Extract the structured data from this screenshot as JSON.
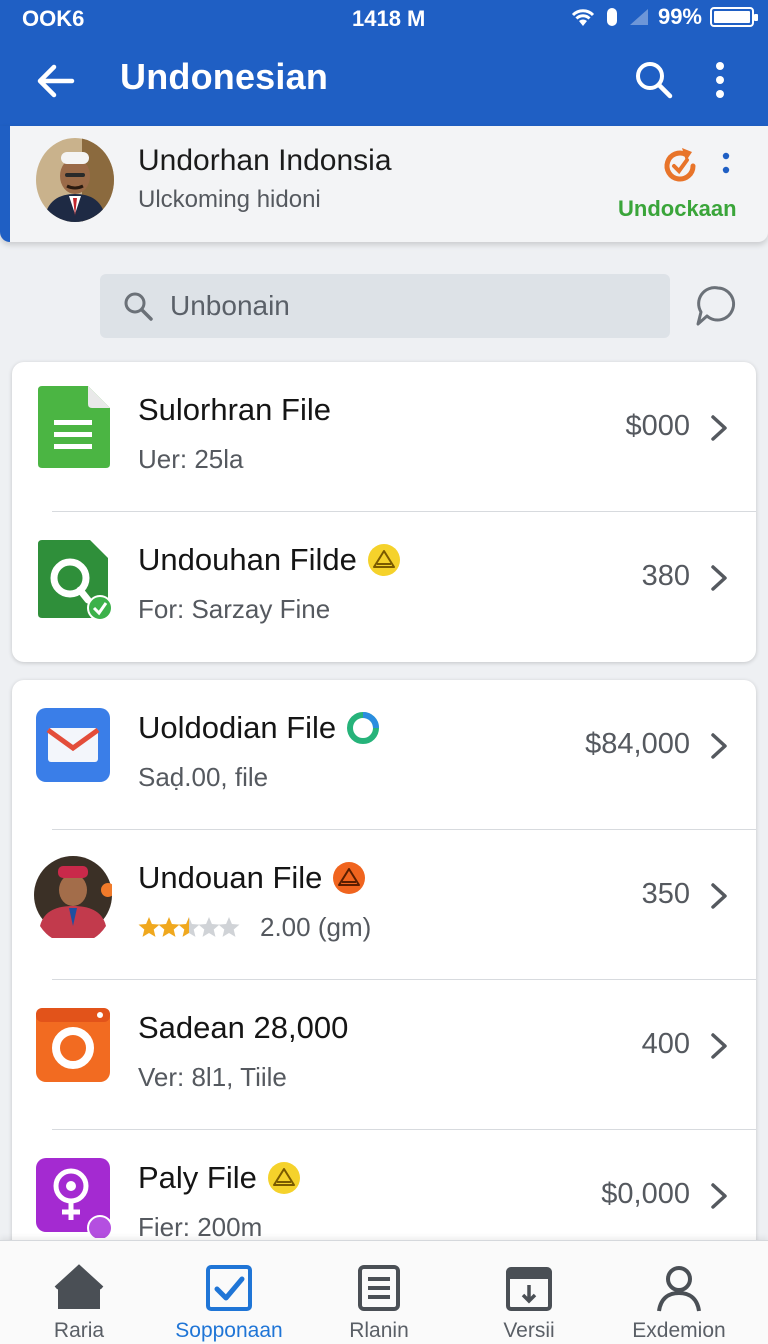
{
  "status_bar": {
    "left_text": "OOK6",
    "time": "1418 M",
    "battery": "99%",
    "battery_level": 0.99
  },
  "app_bar": {
    "title": "Undonesian",
    "back_icon": "arrow-left-icon",
    "search_icon": "search-icon",
    "more_icon": "more-vertical-icon"
  },
  "profile": {
    "name": "Undorhan Indonsia",
    "subtitle": "Ulckoming hidoni",
    "status": "Undockaan",
    "status_color": "#3aa53a",
    "sync_icon": "sync-icon"
  },
  "search": {
    "placeholder": "Unbonain",
    "chat_icon": "chat-bubble-icon"
  },
  "list_groups": [
    {
      "items": [
        {
          "title": "Sulorhran File",
          "subtitle": "Uer: 25la",
          "value": "$000",
          "icon": "green-sheet-file-icon"
        },
        {
          "title": "Undouhan Filde",
          "subtitle": "For: Sarzay Fine",
          "value": "380",
          "icon": "green-search-file-icon",
          "badge": "yellow-warning-badge-icon"
        }
      ]
    },
    {
      "items": [
        {
          "title": "Uoldodian File",
          "subtitle": "Saḍ.00, file",
          "value": "$84,000",
          "icon": "mail-app-icon",
          "badge": "green-ring-badge-icon"
        },
        {
          "title": "Undouan File",
          "subtitle": "2.00 (gm)",
          "rating": 2.5,
          "rating_max": 5,
          "value": "350",
          "icon": "person-avatar-icon",
          "badge": "orange-warning-badge-icon"
        },
        {
          "title": "Sadean 28,000",
          "subtitle": "Ver: 8l1, Tiile",
          "value": "400",
          "icon": "orange-record-app-icon"
        },
        {
          "title": "Paly File",
          "subtitle": "Fier: 200m",
          "value": "$0,000",
          "icon": "purple-location-app-icon",
          "badge": "yellow-warning-badge-icon"
        }
      ]
    }
  ],
  "bottom_nav": [
    {
      "label": "Raria",
      "icon": "home-icon",
      "active": false
    },
    {
      "label": "Sopponaan",
      "icon": "checkbox-icon",
      "active": true
    },
    {
      "label": "Rlanin",
      "icon": "document-list-icon",
      "active": false
    },
    {
      "label": "Versii",
      "icon": "calendar-download-icon",
      "active": false
    },
    {
      "label": "Exdemion",
      "icon": "person-icon",
      "active": false
    }
  ],
  "colors": {
    "primary": "#1f5fc4",
    "active_nav": "#1f75d6",
    "status_green": "#3aa53a"
  }
}
